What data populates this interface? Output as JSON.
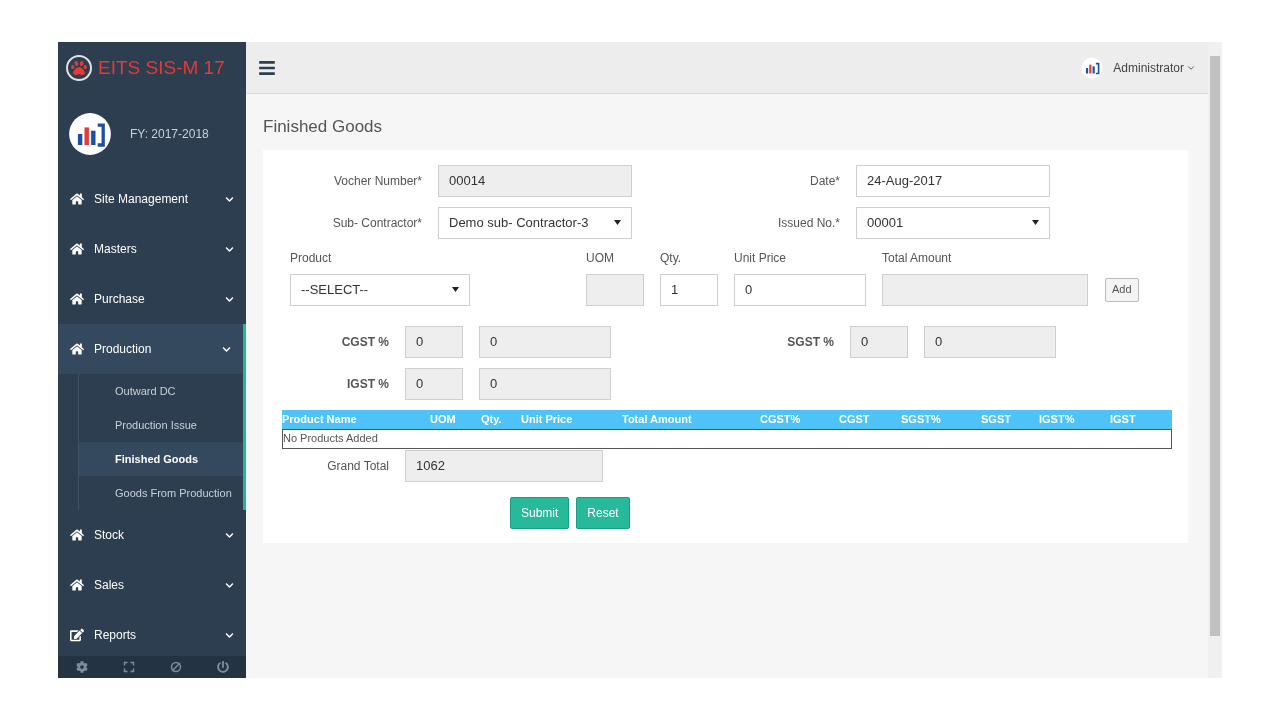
{
  "app": {
    "title": "EITS SIS-M 17",
    "fiscal_year": "FY: 2017-2018"
  },
  "sidebar": {
    "items": [
      {
        "label": "Site Management",
        "expanded": false
      },
      {
        "label": "Masters",
        "expanded": false
      },
      {
        "label": "Purchase",
        "expanded": false
      },
      {
        "label": "Production",
        "expanded": true,
        "children": [
          {
            "label": "Outward DC",
            "selected": false
          },
          {
            "label": "Production Issue",
            "selected": false
          },
          {
            "label": "Finished Goods",
            "selected": true
          },
          {
            "label": "Goods From Production",
            "selected": false
          }
        ]
      },
      {
        "label": "Stock",
        "expanded": false
      },
      {
        "label": "Sales",
        "expanded": false
      },
      {
        "label": "Reports",
        "expanded": false
      }
    ]
  },
  "header": {
    "user": "Administrator"
  },
  "page": {
    "title": "Finished Goods"
  },
  "form": {
    "voucher_number": {
      "label": "Vocher Number*",
      "value": "00014"
    },
    "date": {
      "label": "Date*",
      "value": "24-Aug-2017"
    },
    "sub_contractor": {
      "label": "Sub- Contractor*",
      "value": "Demo sub- Contractor-3"
    },
    "issued_no": {
      "label": "Issued No.*",
      "value": "00001"
    },
    "product": {
      "label": "Product",
      "value": "--SELECT--"
    },
    "uom": {
      "label": "UOM"
    },
    "qty": {
      "label": "Qty.",
      "value": "1"
    },
    "unit_price": {
      "label": "Unit Price",
      "value": "0"
    },
    "total_amount": {
      "label": "Total Amount"
    },
    "add_button": "Add",
    "cgst": {
      "label": "CGST %",
      "percent": "0",
      "amount": "0"
    },
    "sgst": {
      "label": "SGST %",
      "percent": "0",
      "amount": "0"
    },
    "igst": {
      "label": "IGST %",
      "percent": "0",
      "amount": "0"
    },
    "grand_total": {
      "label": "Grand Total",
      "value": "1062"
    }
  },
  "table": {
    "columns": [
      "Product Name",
      "UOM",
      "Qty.",
      "Unit Price",
      "Total Amount",
      "CGST%",
      "CGST",
      "SGST%",
      "SGST",
      "IGST%",
      "IGST"
    ],
    "empty_text": "No Products Added"
  },
  "buttons": [
    "Submit",
    "Reset"
  ]
}
